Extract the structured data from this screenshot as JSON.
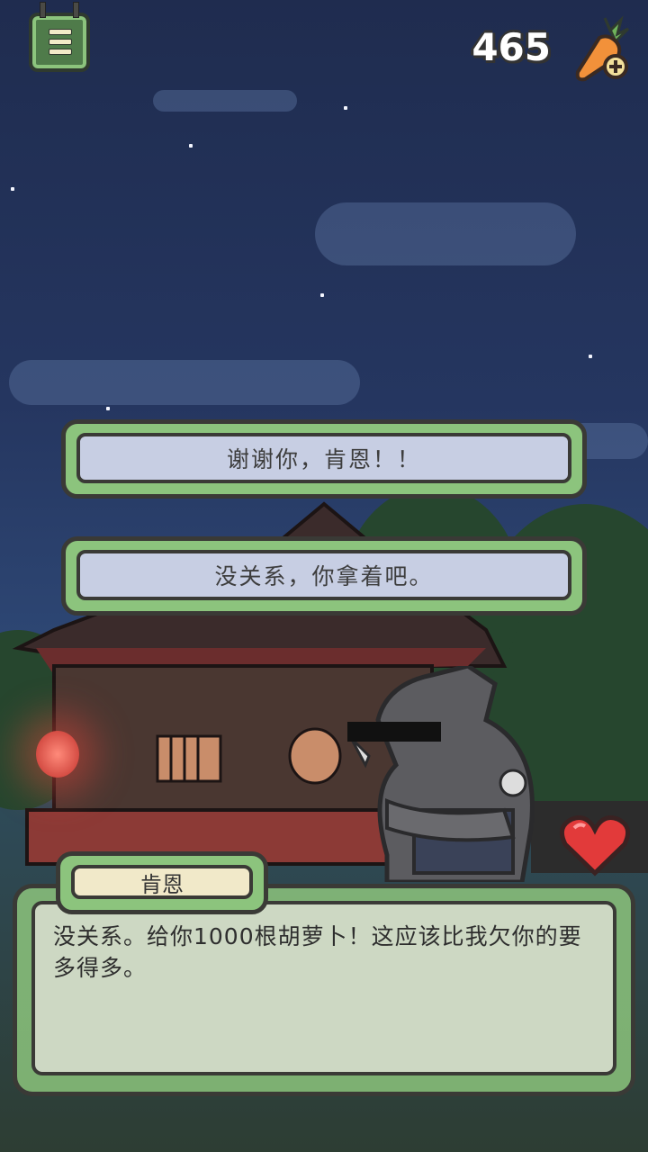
{
  "hud": {
    "carrot_count": "465",
    "menu_icon": "menu-icon",
    "carrot_icon": "carrot-add-icon"
  },
  "choices": [
    {
      "label": "谢谢你，肯恩！！"
    },
    {
      "label": "没关系，你拿着吧。"
    }
  ],
  "dialog": {
    "speaker": "肯恩",
    "text": "没关系。给你1000根胡萝卜！这应该比我欠你的要多得多。"
  },
  "colors": {
    "panel_green": "#8cc47d",
    "choice_fill": "#c7cee3",
    "name_fill": "#f1e9c9",
    "sky": "#253660",
    "heart": "#e23a3a"
  }
}
